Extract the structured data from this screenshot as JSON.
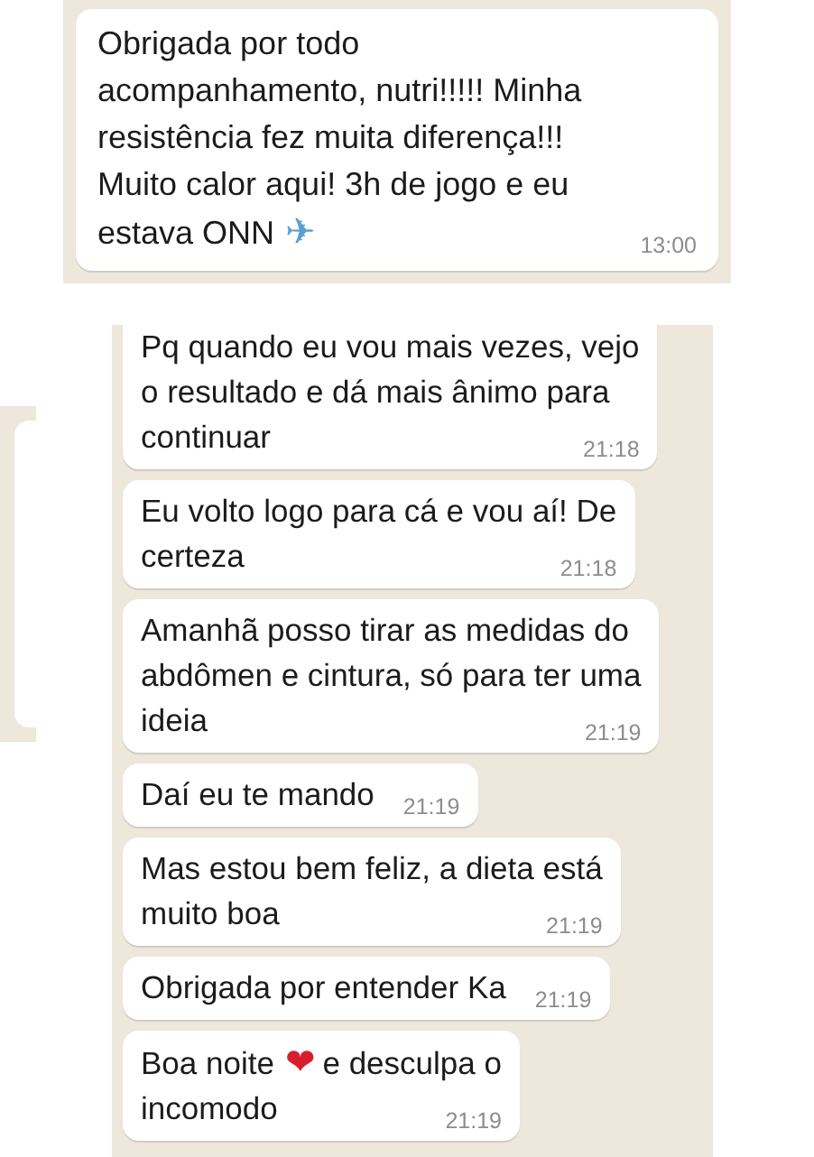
{
  "chats": [
    {
      "messages": [
        {
          "lines": [
            [
              {
                "kind": "text",
                "text": "Obrigada por todo"
              }
            ],
            [
              {
                "kind": "text",
                "text": "acompanhamento, nutri!!!!! Minha"
              }
            ],
            [
              {
                "kind": "text",
                "text": "resistência fez muita diferença!!!"
              }
            ],
            [
              {
                "kind": "text",
                "text": "Muito calor aqui! 3h de jogo e eu"
              }
            ],
            [
              {
                "kind": "text",
                "text": "estava ONN"
              },
              {
                "kind": "emoji",
                "text": "✈",
                "color": "#5a9fd4"
              }
            ]
          ],
          "time": "13:00"
        }
      ]
    },
    {
      "messages": [
        {
          "lines": [
            [
              {
                "kind": "text",
                "text": "Pq quando eu vou mais vezes, vejo"
              }
            ],
            [
              {
                "kind": "text",
                "text": "o resultado e dá mais ânimo para"
              }
            ],
            [
              {
                "kind": "text",
                "text": "continuar"
              }
            ]
          ],
          "time": "21:18"
        },
        {
          "lines": [
            [
              {
                "kind": "text",
                "text": "Eu volto logo para cá e vou aí! De"
              }
            ],
            [
              {
                "kind": "text",
                "text": "certeza"
              }
            ]
          ],
          "time": "21:18"
        },
        {
          "lines": [
            [
              {
                "kind": "text",
                "text": "Amanhã posso tirar as medidas do"
              }
            ],
            [
              {
                "kind": "text",
                "text": "abdômen e cintura, só para ter uma"
              }
            ],
            [
              {
                "kind": "text",
                "text": "ideia"
              }
            ]
          ],
          "time": "21:19"
        },
        {
          "lines": [
            [
              {
                "kind": "text",
                "text": "Daí eu te mando"
              }
            ]
          ],
          "time": "21:19"
        },
        {
          "lines": [
            [
              {
                "kind": "text",
                "text": "Mas estou bem feliz, a dieta está"
              }
            ],
            [
              {
                "kind": "text",
                "text": "muito boa"
              }
            ]
          ],
          "time": "21:19"
        },
        {
          "lines": [
            [
              {
                "kind": "text",
                "text": "Obrigada por entender Ka"
              }
            ]
          ],
          "time": "21:19"
        },
        {
          "lines": [
            [
              {
                "kind": "text",
                "text": "Boa noite"
              },
              {
                "kind": "emoji",
                "text": "❤",
                "color": "#d81e2c"
              },
              {
                "kind": "text",
                "text": "e desculpa o"
              }
            ],
            [
              {
                "kind": "text",
                "text": "incomodo"
              }
            ]
          ],
          "time": "21:19"
        }
      ]
    }
  ]
}
